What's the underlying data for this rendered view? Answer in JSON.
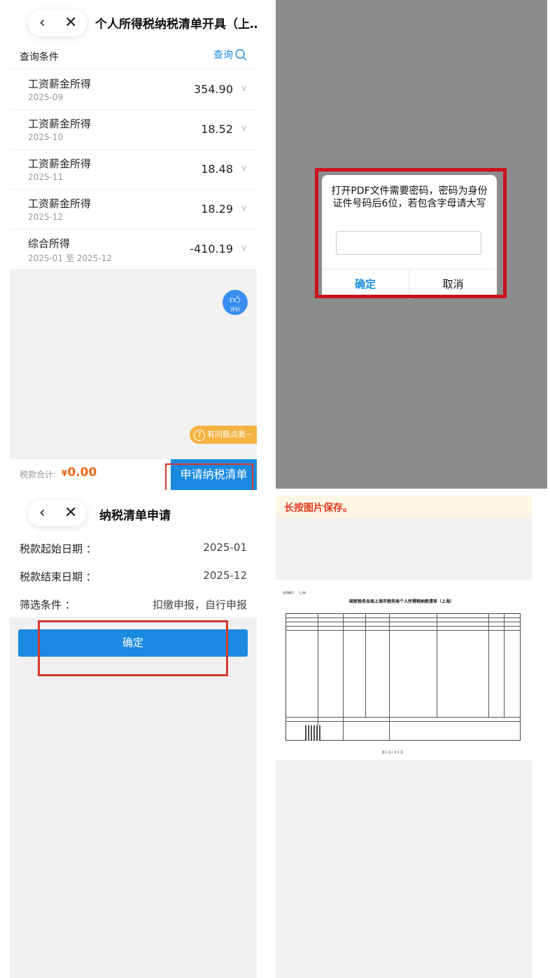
{
  "panel_list": {
    "nav": {
      "back_icon": "chevron-left-icon",
      "close_icon": "close-icon",
      "title": "个人所得税纳税清单开具（上…"
    },
    "query": {
      "label": "查询条件",
      "button": "查询"
    },
    "rows": [
      {
        "title": "工资薪金所得",
        "date": "2025-09",
        "value": "354.90"
      },
      {
        "title": "工资薪金所得",
        "date": "2025-10",
        "value": "18.52"
      },
      {
        "title": "工资薪金所得",
        "date": "2025-11",
        "value": "18.48"
      },
      {
        "title": "工资薪金所得",
        "date": "2025-12",
        "value": "18.29"
      },
      {
        "title": "综合所得",
        "date": "2025-01 至 2025-12",
        "value": "-410.19"
      }
    ],
    "rate_label": "评价",
    "help": "有问题点我~",
    "sum_label": "税款合计:",
    "sum_currency": "¥",
    "sum_value": "0.00",
    "apply_button": "申请纳税清单",
    "colors": {
      "accent": "#1a8ae0",
      "sum": "#f06a18",
      "highlight": "#d6382a"
    }
  },
  "panel_dialog": {
    "message": "打开PDF文件需要密码，密码为身份证件号码后6位，若包含字母请大写",
    "input_value": "",
    "ok": "确定",
    "cancel": "取消"
  },
  "panel_apply": {
    "title": "纳税清单申请",
    "fields": [
      {
        "label": "税款起始日期 ：",
        "value": "2025-01"
      },
      {
        "label": "税款结束日期 ：",
        "value": "2025-12"
      },
      {
        "label": "筛选条件 ：",
        "value": "扣缴申报，自行申报"
      }
    ],
    "ok": "确定"
  },
  "panel_doc": {
    "hint": "长按图片保存。",
    "doc_title": "国家税务总局上海市税务局个人所得税纳税清单（上海）",
    "doc_no": "证明编号：（上海）",
    "page": "第 1 页 / 共 1 页"
  }
}
